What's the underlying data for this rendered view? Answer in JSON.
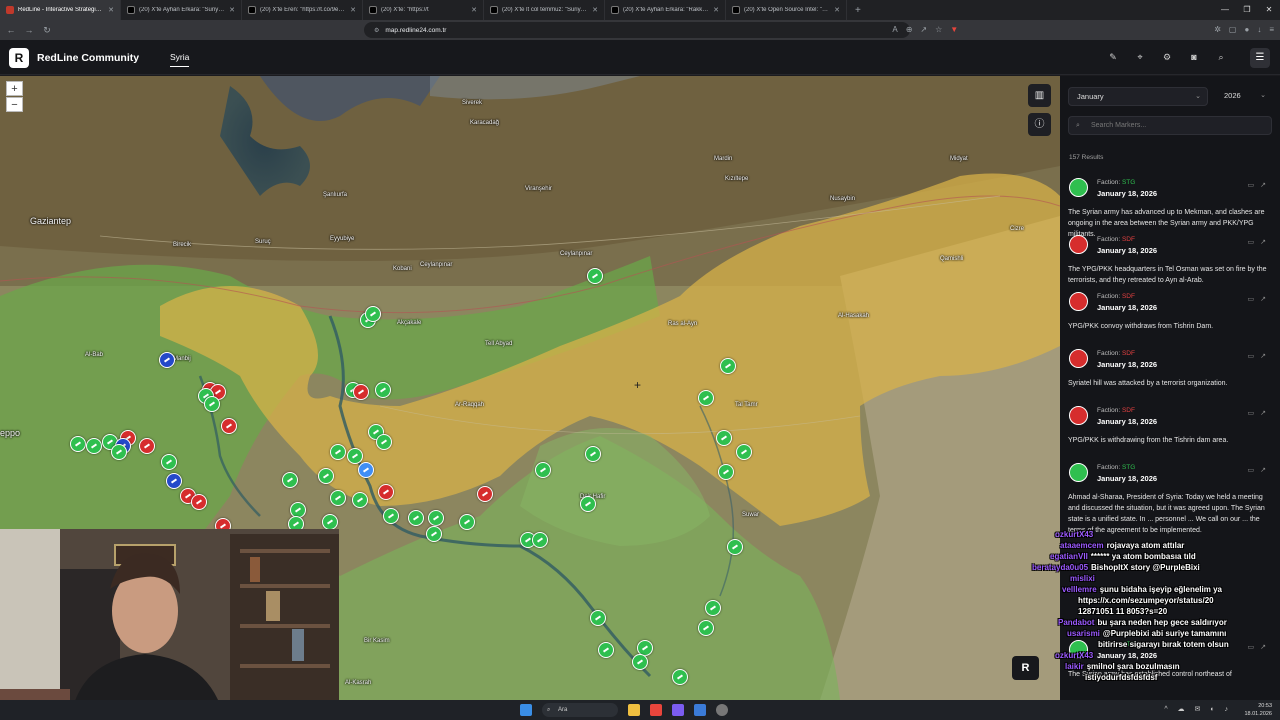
{
  "browser": {
    "tabs": [
      {
        "title": "RedLine - Interactive Strategic M",
        "active": true
      },
      {
        "title": "(20) X'te Ayhan Erkara: \"Suriye ordusu",
        "active": false
      },
      {
        "title": "(20) X'te Eren: \"https://t.co/9ebqVe",
        "active": false
      },
      {
        "title": "(20) X'te: \"https://t",
        "active": false
      },
      {
        "title": "(20) X'te lt col temmuz: \"Suriye Ordusu",
        "active": false
      },
      {
        "title": "(20) X'te Ayhan Erkara: \"Rakka hala ta",
        "active": false
      },
      {
        "title": "(20) X'te Open Source Intel: \"NEW",
        "active": false
      }
    ],
    "new_tab": "+",
    "url": "map.redline24.com.tr",
    "window_controls": [
      "—",
      "❐",
      "✕"
    ]
  },
  "header": {
    "logo": "R",
    "app_name": "RedLine Community",
    "nav_active": "Syria",
    "icons": [
      "draw-icon",
      "pin-icon",
      "settings-icon",
      "camera-icon",
      "search-icon"
    ],
    "menu_glyph": "☰"
  },
  "map": {
    "zoom_in": "+",
    "zoom_out": "−",
    "controls": [
      "map-layers-icon",
      "info-icon"
    ],
    "cities": [
      {
        "name": "Gaziantep",
        "big": true
      },
      {
        "name": "Şanlıurfa",
        "big": false
      },
      {
        "name": "Mardin",
        "big": false
      },
      {
        "name": "Eyyubiye",
        "big": false
      },
      {
        "name": "Viranşehir",
        "big": false
      },
      {
        "name": "Ceylanpınar",
        "big": false
      },
      {
        "name": "Kızıltepe",
        "big": false
      },
      {
        "name": "Nusaybin",
        "big": false
      },
      {
        "name": "Suruç",
        "big": false
      },
      {
        "name": "Birecik",
        "big": false
      },
      {
        "name": "Akçakale",
        "big": false
      },
      {
        "name": "Tell Abyad",
        "big": false
      },
      {
        "name": "Ras al-Ayn",
        "big": false
      },
      {
        "name": "Al-Hasakah",
        "big": false
      },
      {
        "name": "Qamishli",
        "big": false
      },
      {
        "name": "Ar-Raqqah",
        "big": false
      },
      {
        "name": "Manbij",
        "big": false
      },
      {
        "name": "Al-Bab",
        "big": false
      },
      {
        "name": "eppo",
        "big": true
      },
      {
        "name": "Tal Tamr",
        "big": false
      },
      {
        "name": "Suwar",
        "big": false
      },
      {
        "name": "Bir Kasim",
        "big": false
      },
      {
        "name": "Al-Kasrah",
        "big": false
      },
      {
        "name": "Ceylanpınar",
        "big": false
      },
      {
        "name": "Karacadağ",
        "big": false
      },
      {
        "name": "Siverek",
        "big": false
      },
      {
        "name": "Midyat",
        "big": false
      },
      {
        "name": "Cizre",
        "big": false
      },
      {
        "name": "Kobani",
        "big": false
      },
      {
        "name": "Deir Hafir",
        "big": false
      }
    ]
  },
  "sidebar": {
    "month": "January",
    "year": "2026",
    "search_placeholder": "Search Markers...",
    "results": "157 Results",
    "faction_label": "Faction:",
    "entries": [
      {
        "faction": "STG",
        "date": "January 18, 2026",
        "text": "The Syrian army has advanced up to Mekman, and clashes are ongoing in the area between the Syrian army and PKK/YPG militants.",
        "color": "g"
      },
      {
        "faction": "SDF",
        "date": "January 18, 2026",
        "text": "The YPG/PKK headquarters in Tel Osman was set on fire by the terrorists, and they retreated to Ayn al-Arab.",
        "color": "r"
      },
      {
        "faction": "SDF",
        "date": "January 18, 2026",
        "text": "YPG/PKK convoy withdraws from Tishrin Dam.",
        "color": "r"
      },
      {
        "faction": "SDF",
        "date": "January 18, 2026",
        "text": "Syriatel hill was attacked by a terrorist organization.",
        "color": "r"
      },
      {
        "faction": "SDF",
        "date": "January 18, 2026",
        "text": "YPG/PKK is withdrawing from the Tishrin dam area.",
        "color": "r"
      },
      {
        "faction": "STG",
        "date": "January 18, 2026",
        "text": "Ahmad al-Sharaa, President of Syria: Today we held a meeting and discussed the situation, but it was agreed upon. The Syrian state is a unified state. In ... personnel ... We call on our ... the terms of the agreement to be implemented.",
        "color": "g"
      },
      {
        "faction": "STG",
        "date": "January 18, 2026",
        "text": "The Syrian army has established control northeast of",
        "color": "g"
      }
    ]
  },
  "chat": [
    {
      "user": "ozkurtX43",
      "msg": ""
    },
    {
      "user": "ataaemcem",
      "msg": "rojavaya atom attılar"
    },
    {
      "user": "egatianVII",
      "msg": "****** ya atom bombasıa tıld"
    },
    {
      "user": "beratayda0u05",
      "msg": "BishopltX story @PurpleBixi"
    },
    {
      "user": "mislixi",
      "msg": ""
    },
    {
      "user": "velllemre",
      "msg": "şunu bidaha işeyip eğlenelim ya"
    },
    {
      "user": "",
      "msg": "https://x.com/sezumpeyor/status/20"
    },
    {
      "user": "",
      "msg": "12871051 11 8053?s=20"
    },
    {
      "user": "Pandabot",
      "msg": "bu şara neden hep gece saldırıyor"
    },
    {
      "user": "usarismi",
      "msg": "@Purplebixi abi suriye tamamını"
    },
    {
      "user": "",
      "msg": "bitirirse sigarayı bırak totem olsun"
    },
    {
      "user": "ozkurtX43",
      "msg": ""
    },
    {
      "user": "laikir",
      "msg": "şmilnol şara bozulmasın"
    },
    {
      "user": "",
      "msg": "istiyodurfdsfdsfdsf"
    }
  ],
  "badge": "R",
  "taskbar": {
    "search": "Ara",
    "time": "20:53",
    "date": "18.01.2026"
  }
}
